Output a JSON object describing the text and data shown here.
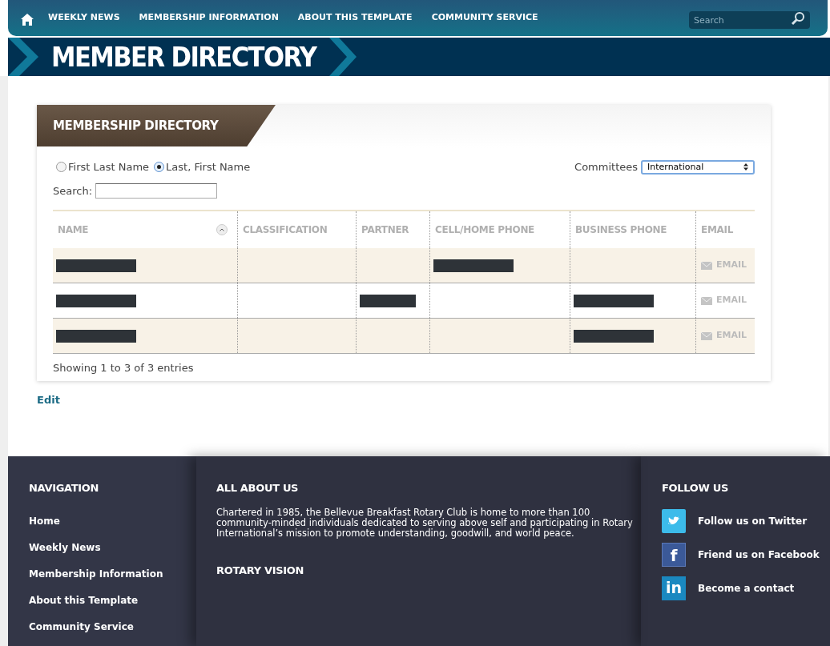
{
  "nav": {
    "items": [
      "WEEKLY NEWS",
      "MEMBERSHIP INFORMATION",
      "ABOUT THIS TEMPLATE",
      "COMMUNITY SERVICE"
    ],
    "search": {
      "placeholder": "Search"
    }
  },
  "page_title": "MEMBER DIRECTORY",
  "panel": {
    "title": "MEMBERSHIP DIRECTORY",
    "name_format": [
      {
        "label": "First Last Name",
        "selected": false
      },
      {
        "label": "Last, First Name",
        "selected": true
      }
    ],
    "committees": {
      "label": "Committees",
      "value": "International"
    },
    "search": {
      "label": "Search:"
    },
    "table": {
      "columns": [
        {
          "label": "NAME",
          "sortable": true
        },
        {
          "label": "CLASSIFICATION",
          "sortable": false
        },
        {
          "label": "PARTNER",
          "sortable": false
        },
        {
          "label": "CELL/HOME PHONE",
          "sortable": false
        },
        {
          "label": "BUSINESS PHONE",
          "sortable": false
        },
        {
          "label": "EMAIL",
          "sortable": false
        }
      ],
      "rows": [
        {
          "redacted": [
            true,
            false,
            false,
            true,
            false
          ],
          "email": "EMAIL"
        },
        {
          "redacted": [
            true,
            false,
            true,
            false,
            true
          ],
          "email": "EMAIL"
        },
        {
          "redacted": [
            true,
            false,
            false,
            false,
            true
          ],
          "email": "EMAIL"
        }
      ]
    },
    "info": "Showing 1 to 3 of 3 entries"
  },
  "edit_link": "Edit",
  "footer": {
    "navigation": {
      "title": "NAVIGATION",
      "items": [
        "Home",
        "Weekly News",
        "Membership Information",
        "About this Template",
        "Community Service"
      ]
    },
    "about": {
      "title": "ALL ABOUT US",
      "text": "Chartered in 1985, the Bellevue Breakfast Rotary Club is home to more than 100 community-minded individuals dedicated to serving above self and participating in Rotary International’s mission to promote understanding, goodwill, and world peace.",
      "subtitle": "ROTARY VISION"
    },
    "follow": {
      "title": "FOLLOW US",
      "items": [
        {
          "kind": "twitter",
          "label": "Follow us on Twitter"
        },
        {
          "kind": "facebook",
          "glyph": "f",
          "label": "Friend us on Facebook"
        },
        {
          "kind": "linkedin",
          "glyph": "in",
          "label": "Become a contact"
        }
      ]
    }
  }
}
